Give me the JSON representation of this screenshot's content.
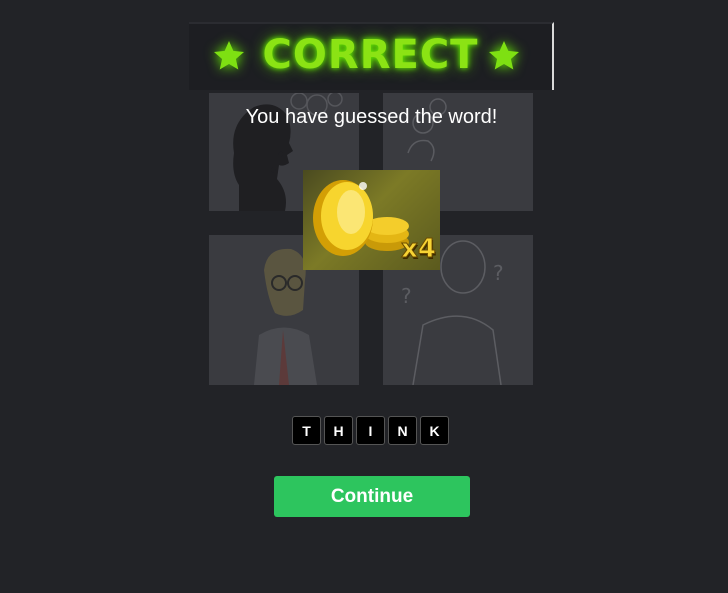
{
  "banner": {
    "title": "CORRECT",
    "icon_left": "star-icon",
    "icon_right": "star-icon",
    "glow_color": "#8be314"
  },
  "message": "You have guessed the word!",
  "reward": {
    "multiplier": "x4",
    "icon": "gold-coins-icon"
  },
  "answer_letters": [
    "T",
    "H",
    "I",
    "N",
    "K"
  ],
  "continue_label": "Continue",
  "colors": {
    "background": "#222327",
    "button": "#2dc55e"
  }
}
